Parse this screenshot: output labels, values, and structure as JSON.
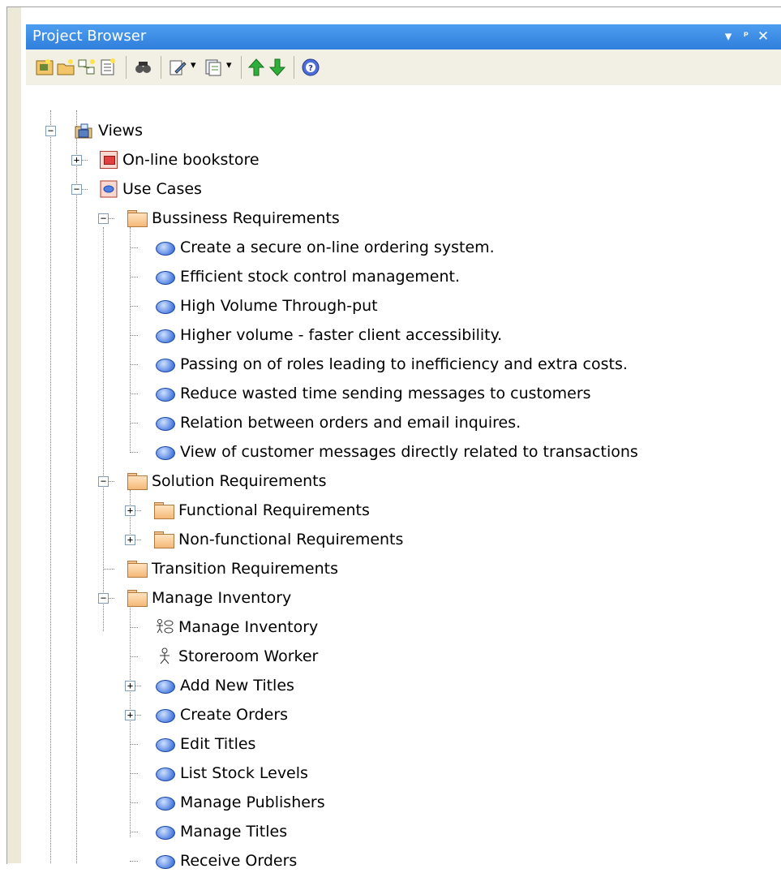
{
  "panel": {
    "title": "Project Browser"
  },
  "titlebar_buttons": [
    "dropdown-arrow",
    "pin",
    "close"
  ],
  "toolbar": {
    "tools": [
      "new-model-package",
      "new-view",
      "new-diagram",
      "new-element",
      "find-in-project",
      "properties",
      "document-options",
      "move-up",
      "move-down",
      "help"
    ]
  },
  "colors": {
    "titlebar": "#3a8ae6",
    "toolbar": "#f2efe4",
    "folder": "#f7c88c",
    "usecase": "#4f7fe0"
  },
  "tree": {
    "root": {
      "label": "Views",
      "expanded": true
    },
    "nodes": [
      {
        "label": "On-line bookstore",
        "icon": "package-icon",
        "expander": "+"
      },
      {
        "label": "Use Cases",
        "icon": "usecase-package-icon",
        "expander": "-"
      },
      {
        "label": "Bussiness Requirements",
        "icon": "folder-icon",
        "expander": "-"
      },
      {
        "label": "Create a secure on-line ordering system.",
        "icon": "usecase-icon"
      },
      {
        "label": "Efficient stock control management.",
        "icon": "usecase-icon"
      },
      {
        "label": "High Volume Through-put",
        "icon": "usecase-icon"
      },
      {
        "label": "Higher volume - faster client accessibility.",
        "icon": "usecase-icon"
      },
      {
        "label": "Passing on of roles leading to inefficiency and extra costs.",
        "icon": "usecase-icon"
      },
      {
        "label": "Reduce wasted time sending messages to customers",
        "icon": "usecase-icon"
      },
      {
        "label": "Relation between orders and  email inquires.",
        "icon": "usecase-icon"
      },
      {
        "label": "View of customer messages directly related to transactions",
        "icon": "usecase-icon"
      },
      {
        "label": "Solution Requirements",
        "icon": "folder-icon",
        "expander": "-"
      },
      {
        "label": "Functional Requirements",
        "icon": "folder-icon",
        "expander": "+"
      },
      {
        "label": "Non-functional Requirements",
        "icon": "folder-icon",
        "expander": "+"
      },
      {
        "label": "Transition Requirements",
        "icon": "folder-icon"
      },
      {
        "label": "Manage Inventory",
        "icon": "folder-icon",
        "expander": "-"
      },
      {
        "label": "Manage Inventory",
        "icon": "usecase-diagram-icon"
      },
      {
        "label": "Storeroom Worker",
        "icon": "actor-icon"
      },
      {
        "label": "Add New Titles",
        "icon": "usecase-icon",
        "expander": "+"
      },
      {
        "label": "Create Orders",
        "icon": "usecase-icon",
        "expander": "+"
      },
      {
        "label": "Edit Titles",
        "icon": "usecase-icon"
      },
      {
        "label": "List Stock Levels",
        "icon": "usecase-icon"
      },
      {
        "label": "Manage Publishers",
        "icon": "usecase-icon"
      },
      {
        "label": "Manage Titles",
        "icon": "usecase-icon"
      },
      {
        "label": "Receive Orders",
        "icon": "usecase-icon"
      }
    ]
  }
}
